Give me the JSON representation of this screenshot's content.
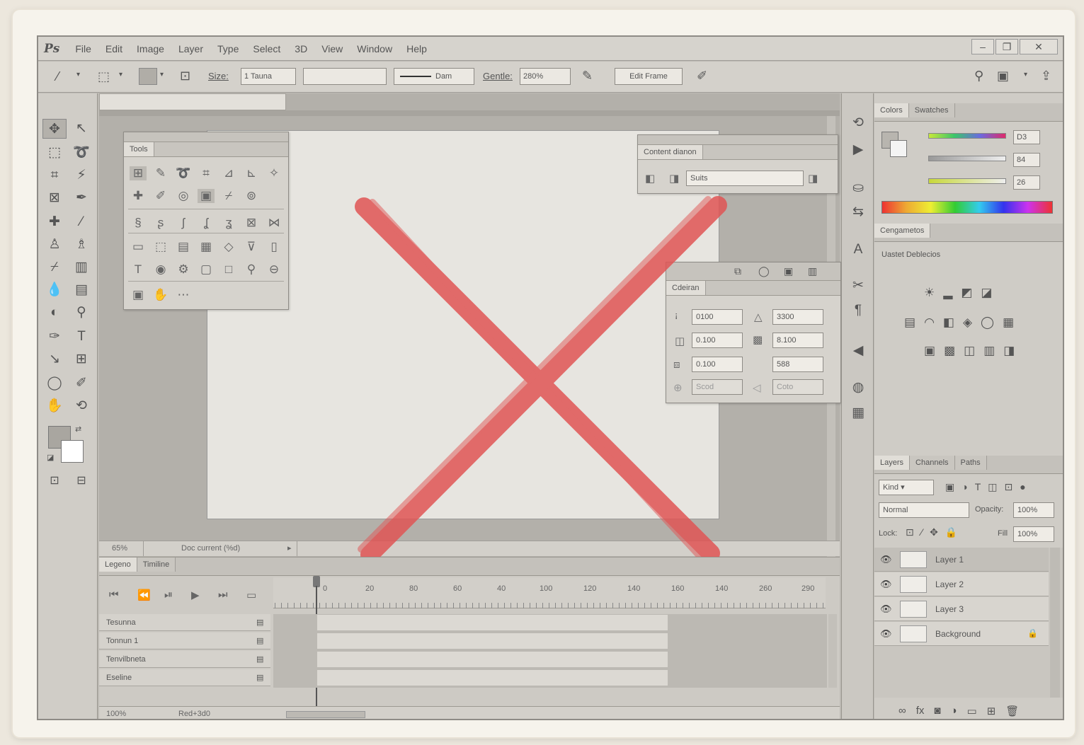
{
  "app": {
    "logo": "Ps",
    "menu": [
      "File",
      "Edit",
      "Image",
      "Layer",
      "Type",
      "Select",
      "3D",
      "View",
      "Window",
      "Help"
    ],
    "window_controls": [
      "–",
      "❐",
      "✕"
    ]
  },
  "options_bar": {
    "size_label": "Size:",
    "size_value": "1 Tauna",
    "brush_label": "Dam",
    "gentle_label": "Gentle:",
    "gentle_value": "280%",
    "frame_button": "Edit Frame"
  },
  "tools_panel": {
    "tab": "Tools"
  },
  "content_panel": {
    "tab": "Content dianon",
    "field": "Suits"
  },
  "character_panel": {
    "tab": "Cdeiran",
    "fields": [
      "0100",
      "3300",
      "0.100",
      "8.100",
      "0.100",
      "588",
      "Scod",
      "Coto"
    ]
  },
  "document": {
    "status_zoom": "65%",
    "status_text": "Doc current (%d)"
  },
  "timeline": {
    "tabs": [
      "Legeno",
      "Timiline"
    ],
    "ruler": [
      "0",
      "20",
      "80",
      "60",
      "40",
      "100",
      "120",
      "140",
      "160",
      "140",
      "260",
      "290"
    ],
    "tracks": [
      "Tesunna",
      "Tonnun 1",
      "Tenvilbneta",
      "Eseline"
    ],
    "footer_zoom": "100%",
    "footer_text": "Red+3d0"
  },
  "color_panel": {
    "tabs": [
      "Colors",
      "Swatches"
    ],
    "values": [
      "D3",
      "84",
      "26"
    ]
  },
  "adjustments_panel": {
    "tab": "Cengametos",
    "subtitle": "Uastet Deblecios"
  },
  "layers_panel": {
    "tabs": [
      "Layers",
      "Channels",
      "Paths"
    ],
    "kind": "Kind",
    "blend_mode": "Normal",
    "opacity_label": "Opacity:",
    "opacity_value": "100%",
    "lock_label": "Lock:",
    "fill_label": "Fill",
    "fill_value": "100%",
    "layers": [
      {
        "name": "Layer 1",
        "selected": true
      },
      {
        "name": "Layer 2",
        "selected": false
      },
      {
        "name": "Layer 3",
        "selected": false
      },
      {
        "name": "Background",
        "selected": false,
        "locked": true
      }
    ]
  },
  "overlay": {
    "mark": "red-x",
    "color": "#e05555"
  }
}
